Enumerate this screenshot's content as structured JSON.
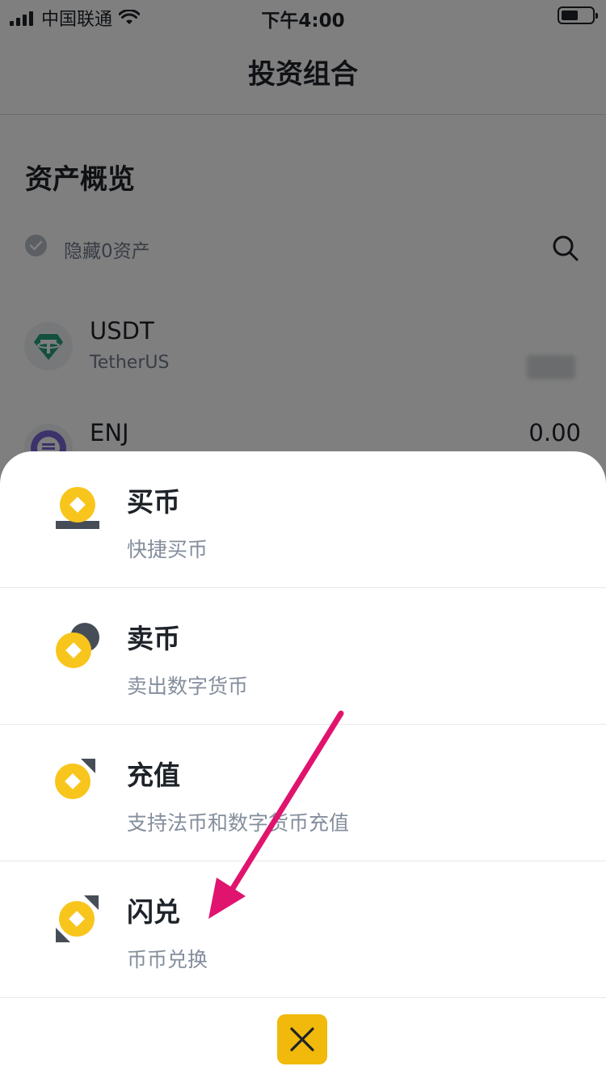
{
  "status_bar": {
    "carrier": "中国联通",
    "time": "下午4:00"
  },
  "header": {
    "title": "投资组合"
  },
  "overview": {
    "title": "资产概览",
    "hide_zero_label": "隐藏0资产"
  },
  "assets": [
    {
      "symbol": "USDT",
      "name": "TetherUS",
      "value": ""
    },
    {
      "symbol": "ENJ",
      "name": "",
      "value": "0.00"
    }
  ],
  "sheet": {
    "items": [
      {
        "title": "买币",
        "subtitle": "快捷买币",
        "icon": "buy-coin-icon"
      },
      {
        "title": "卖币",
        "subtitle": "卖出数字货币",
        "icon": "sell-coin-icon"
      },
      {
        "title": "充值",
        "subtitle": "支持法币和数字货币充值",
        "icon": "deposit-icon"
      },
      {
        "title": "闪兑",
        "subtitle": "币币兑换",
        "icon": "convert-icon"
      }
    ],
    "close_icon": "close-icon"
  },
  "colors": {
    "brand_yellow": "#F0B90B",
    "coin_yellow": "#F8C51C",
    "dark_gray": "#474D57",
    "annotation_arrow": "#E0146E",
    "usdt_green": "#26A17B"
  }
}
